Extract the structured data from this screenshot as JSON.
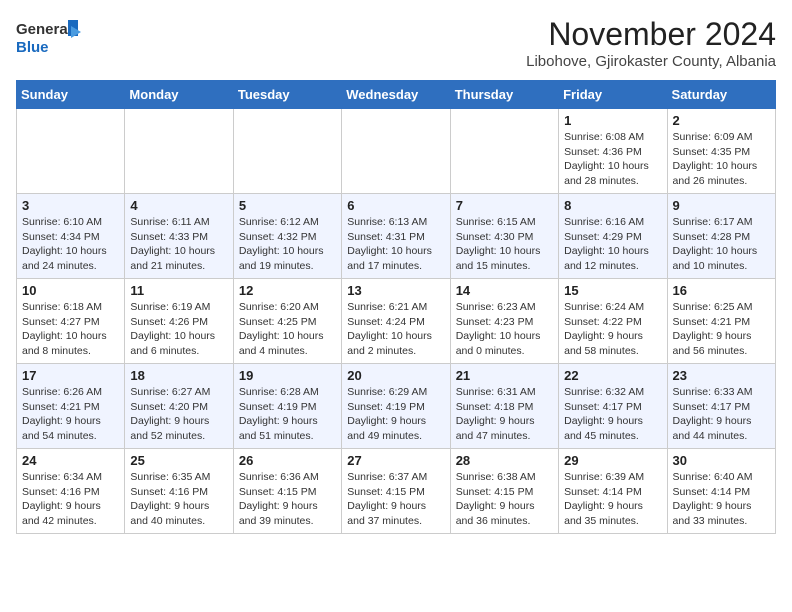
{
  "header": {
    "logo_line1": "General",
    "logo_line2": "Blue",
    "month_title": "November 2024",
    "subtitle": "Libohove, Gjirokaster County, Albania"
  },
  "days_of_week": [
    "Sunday",
    "Monday",
    "Tuesday",
    "Wednesday",
    "Thursday",
    "Friday",
    "Saturday"
  ],
  "weeks": [
    [
      {
        "day": "",
        "info": ""
      },
      {
        "day": "",
        "info": ""
      },
      {
        "day": "",
        "info": ""
      },
      {
        "day": "",
        "info": ""
      },
      {
        "day": "",
        "info": ""
      },
      {
        "day": "1",
        "info": "Sunrise: 6:08 AM\nSunset: 4:36 PM\nDaylight: 10 hours and 28 minutes."
      },
      {
        "day": "2",
        "info": "Sunrise: 6:09 AM\nSunset: 4:35 PM\nDaylight: 10 hours and 26 minutes."
      }
    ],
    [
      {
        "day": "3",
        "info": "Sunrise: 6:10 AM\nSunset: 4:34 PM\nDaylight: 10 hours and 24 minutes."
      },
      {
        "day": "4",
        "info": "Sunrise: 6:11 AM\nSunset: 4:33 PM\nDaylight: 10 hours and 21 minutes."
      },
      {
        "day": "5",
        "info": "Sunrise: 6:12 AM\nSunset: 4:32 PM\nDaylight: 10 hours and 19 minutes."
      },
      {
        "day": "6",
        "info": "Sunrise: 6:13 AM\nSunset: 4:31 PM\nDaylight: 10 hours and 17 minutes."
      },
      {
        "day": "7",
        "info": "Sunrise: 6:15 AM\nSunset: 4:30 PM\nDaylight: 10 hours and 15 minutes."
      },
      {
        "day": "8",
        "info": "Sunrise: 6:16 AM\nSunset: 4:29 PM\nDaylight: 10 hours and 12 minutes."
      },
      {
        "day": "9",
        "info": "Sunrise: 6:17 AM\nSunset: 4:28 PM\nDaylight: 10 hours and 10 minutes."
      }
    ],
    [
      {
        "day": "10",
        "info": "Sunrise: 6:18 AM\nSunset: 4:27 PM\nDaylight: 10 hours and 8 minutes."
      },
      {
        "day": "11",
        "info": "Sunrise: 6:19 AM\nSunset: 4:26 PM\nDaylight: 10 hours and 6 minutes."
      },
      {
        "day": "12",
        "info": "Sunrise: 6:20 AM\nSunset: 4:25 PM\nDaylight: 10 hours and 4 minutes."
      },
      {
        "day": "13",
        "info": "Sunrise: 6:21 AM\nSunset: 4:24 PM\nDaylight: 10 hours and 2 minutes."
      },
      {
        "day": "14",
        "info": "Sunrise: 6:23 AM\nSunset: 4:23 PM\nDaylight: 10 hours and 0 minutes."
      },
      {
        "day": "15",
        "info": "Sunrise: 6:24 AM\nSunset: 4:22 PM\nDaylight: 9 hours and 58 minutes."
      },
      {
        "day": "16",
        "info": "Sunrise: 6:25 AM\nSunset: 4:21 PM\nDaylight: 9 hours and 56 minutes."
      }
    ],
    [
      {
        "day": "17",
        "info": "Sunrise: 6:26 AM\nSunset: 4:21 PM\nDaylight: 9 hours and 54 minutes."
      },
      {
        "day": "18",
        "info": "Sunrise: 6:27 AM\nSunset: 4:20 PM\nDaylight: 9 hours and 52 minutes."
      },
      {
        "day": "19",
        "info": "Sunrise: 6:28 AM\nSunset: 4:19 PM\nDaylight: 9 hours and 51 minutes."
      },
      {
        "day": "20",
        "info": "Sunrise: 6:29 AM\nSunset: 4:19 PM\nDaylight: 9 hours and 49 minutes."
      },
      {
        "day": "21",
        "info": "Sunrise: 6:31 AM\nSunset: 4:18 PM\nDaylight: 9 hours and 47 minutes."
      },
      {
        "day": "22",
        "info": "Sunrise: 6:32 AM\nSunset: 4:17 PM\nDaylight: 9 hours and 45 minutes."
      },
      {
        "day": "23",
        "info": "Sunrise: 6:33 AM\nSunset: 4:17 PM\nDaylight: 9 hours and 44 minutes."
      }
    ],
    [
      {
        "day": "24",
        "info": "Sunrise: 6:34 AM\nSunset: 4:16 PM\nDaylight: 9 hours and 42 minutes."
      },
      {
        "day": "25",
        "info": "Sunrise: 6:35 AM\nSunset: 4:16 PM\nDaylight: 9 hours and 40 minutes."
      },
      {
        "day": "26",
        "info": "Sunrise: 6:36 AM\nSunset: 4:15 PM\nDaylight: 9 hours and 39 minutes."
      },
      {
        "day": "27",
        "info": "Sunrise: 6:37 AM\nSunset: 4:15 PM\nDaylight: 9 hours and 37 minutes."
      },
      {
        "day": "28",
        "info": "Sunrise: 6:38 AM\nSunset: 4:15 PM\nDaylight: 9 hours and 36 minutes."
      },
      {
        "day": "29",
        "info": "Sunrise: 6:39 AM\nSunset: 4:14 PM\nDaylight: 9 hours and 35 minutes."
      },
      {
        "day": "30",
        "info": "Sunrise: 6:40 AM\nSunset: 4:14 PM\nDaylight: 9 hours and 33 minutes."
      }
    ]
  ]
}
